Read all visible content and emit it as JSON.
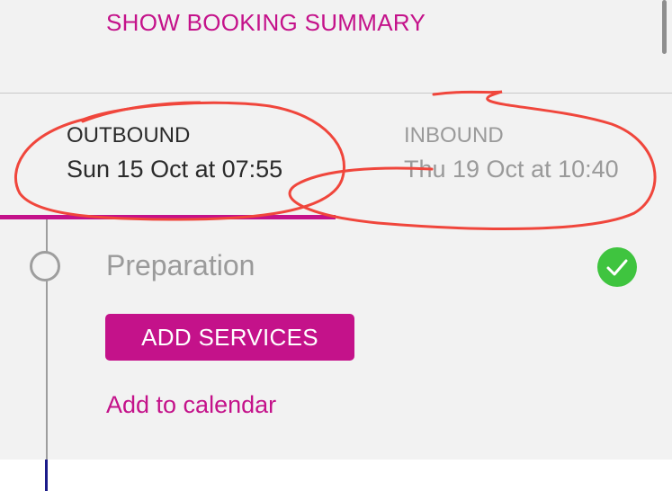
{
  "header": {
    "summary_link": "SHOW BOOKING SUMMARY"
  },
  "tabs": {
    "outbound": {
      "label": "OUTBOUND",
      "date": "Sun 15 Oct at 07:55",
      "active": true
    },
    "inbound": {
      "label": "INBOUND",
      "date": "Thu 19 Oct at 10:40",
      "active": false
    }
  },
  "step": {
    "title": "Preparation",
    "status_icon": "check-circle",
    "add_services_label": "ADD SERVICES",
    "calendar_link": "Add to calendar"
  },
  "colors": {
    "accent": "#c4128a",
    "success": "#3fc43f",
    "annotation": "#f0463c"
  }
}
